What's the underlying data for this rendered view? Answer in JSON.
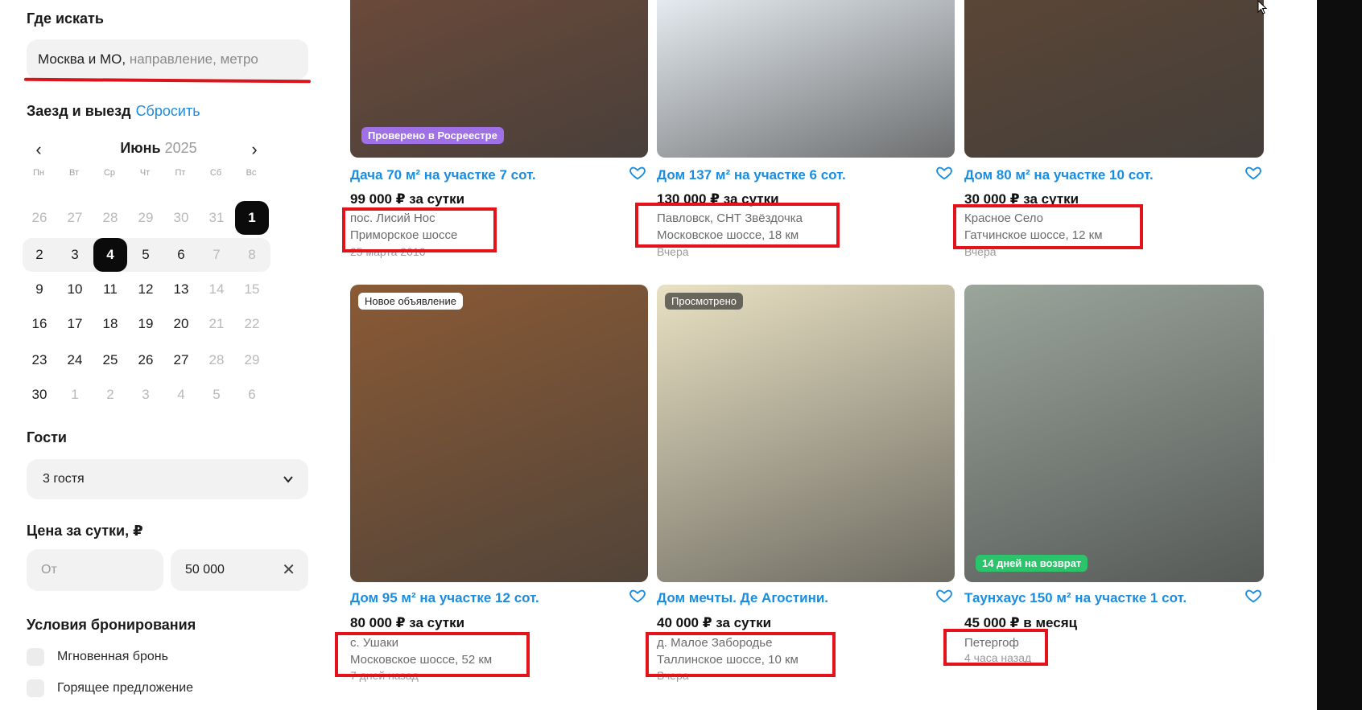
{
  "sidebar": {
    "where_label": "Где искать",
    "search_value": "Москва и МО,",
    "search_placeholder": " направление, метро",
    "dates_label": "Заезд и выезд",
    "reset_label": "Сбросить",
    "calendar": {
      "month": "Июнь",
      "year": "2025",
      "weekdays": [
        "Пн",
        "Вт",
        "Ср",
        "Чт",
        "Пт",
        "Сб",
        "Вс"
      ],
      "weeks": [
        [
          "26",
          "27",
          "28",
          "29",
          "30",
          "31",
          "1"
        ],
        [
          "2",
          "3",
          "4",
          "5",
          "6",
          "7",
          "8"
        ],
        [
          "9",
          "10",
          "11",
          "12",
          "13",
          "14",
          "15"
        ],
        [
          "16",
          "17",
          "18",
          "19",
          "20",
          "21",
          "22"
        ],
        [
          "23",
          "24",
          "25",
          "26",
          "27",
          "28",
          "29"
        ],
        [
          "30",
          "1",
          "2",
          "3",
          "4",
          "5",
          "6"
        ]
      ],
      "selected_start": "1",
      "selected_end": "4"
    },
    "guests_label": "Гости",
    "guests_value": "3 гостя",
    "price_label": "Цена за сутки, ₽",
    "price_from_placeholder": "От",
    "price_to_value": "50 000",
    "conditions_label": "Условия бронирования",
    "conditions": [
      {
        "label": "Мгновенная бронь",
        "checked": false
      },
      {
        "label": "Горящее предложение",
        "checked": false
      }
    ]
  },
  "listings": [
    {
      "title": "Дача 70 м² на участке 7 сот.",
      "price": "99 000 ₽ за сутки",
      "location1": "пос. Лисий Нос",
      "location2": "Приморское шоссе",
      "date": "25 марта 2016",
      "badge": "Проверено в Росреестре",
      "photo_color": "#6b4a3a"
    },
    {
      "title": "Дом 137 м² на участке 6 сот.",
      "price": "130 000 ₽ за сутки",
      "location1": "Павловск, СНТ Звёздочка",
      "location2": "Московское шоссе, 18 км",
      "date": "Вчера",
      "badge": "",
      "photo_color": "#e8eef3"
    },
    {
      "title": "Дом 80 м² на участке 10 сот.",
      "price": "30 000 ₽ за сутки",
      "location1": "Красное Село",
      "location2": "Гатчинское шоссе, 12 км",
      "date": "Вчера",
      "badge": "",
      "photo_color": "#5b4636"
    },
    {
      "title": "Дом 95 м² на участке 12 сот.",
      "price": "80 000 ₽ за сутки",
      "location1": "с. Ушаки",
      "location2": "Московское шоссе, 52 км",
      "date": "7 дней назад",
      "badge": "Новое объявление",
      "photo_color": "#8a5a35"
    },
    {
      "title": "Дом мечты. Де Агостини.",
      "price": "40 000 ₽ за сутки",
      "location1": "д. Малое Забородье",
      "location2": "Таллинское шоссе, 10 км",
      "date": "Вчера",
      "badge": "Просмотрено",
      "photo_color": "#e9e1c3"
    },
    {
      "title": "Таунхаус 150 м² на участке 1 сот.",
      "price": "45 000 ₽ в месяц",
      "location1": "Петергоф",
      "location2": "",
      "date": "4 часа назад",
      "badge": "14 дней на возврат",
      "photo_color": "#9aa59c"
    }
  ]
}
